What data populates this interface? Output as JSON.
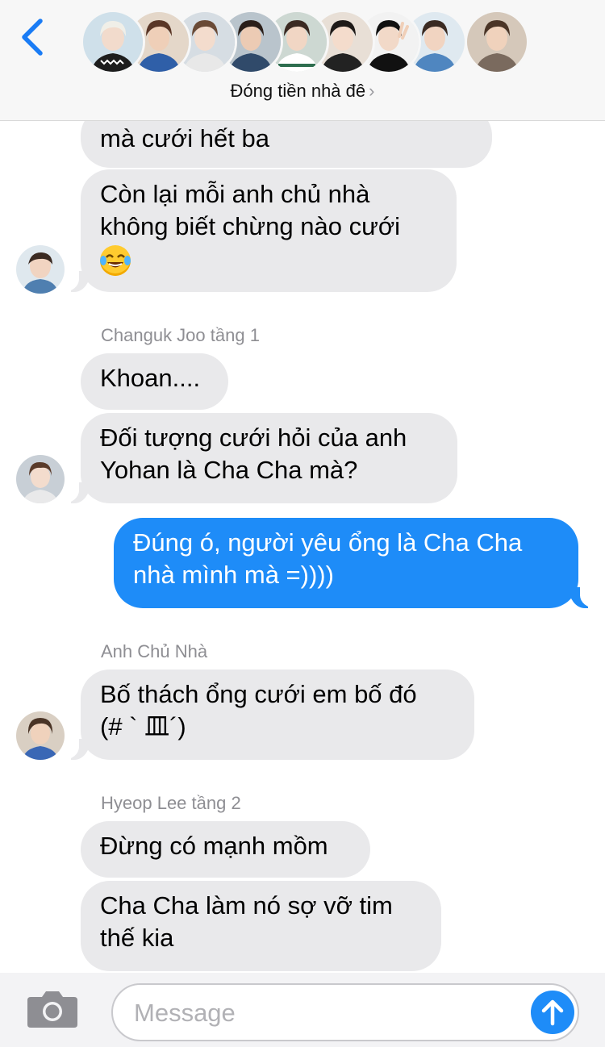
{
  "header": {
    "group_name": "Đóng tiền nhà đê",
    "group_chevron": "›",
    "back_icon": "chevron-left-icon",
    "participants_count": 10
  },
  "messages": [
    {
      "type": "incoming",
      "lines": [
        "mà cưới hết ba"
      ]
    },
    {
      "type": "incoming",
      "lines": [
        "Còn lại mỗi anh chủ nhà",
        "không biết chừng nào cưới"
      ],
      "emoji": "face-with-tears-of-joy-emoji"
    },
    {
      "type": "sender",
      "text": "Changuk Joo tầng 1"
    },
    {
      "type": "incoming",
      "lines": [
        "Khoan...."
      ]
    },
    {
      "type": "incoming",
      "lines": [
        "Đối tượng cưới hỏi của anh",
        "Yohan là Cha Cha mà?"
      ]
    },
    {
      "type": "outgoing",
      "lines": [
        "Đúng ó, người yêu ổng là Cha Cha",
        "nhà mình mà =))))"
      ]
    },
    {
      "type": "sender",
      "text": "Anh Chủ Nhà"
    },
    {
      "type": "incoming",
      "lines": [
        "Bố thách ổng cưới em bố đó",
        "(# ` 皿´)"
      ]
    },
    {
      "type": "sender",
      "text": "Hyeop Lee tầng 2"
    },
    {
      "type": "incoming",
      "lines": [
        "Đừng có mạnh mồm"
      ]
    },
    {
      "type": "incoming",
      "lines": [
        "Cha Cha làm nó sợ vỡ tim",
        "thế kia"
      ]
    }
  ],
  "input_bar": {
    "placeholder": "Message",
    "camera_icon": "camera-icon",
    "send_icon": "arrow-up-send-icon"
  },
  "colors": {
    "accent": "#1e8cf8",
    "incoming_bubble": "#e9e9eb",
    "sender_name": "#8e8e93",
    "back_chevron": "#1a7cf5"
  }
}
